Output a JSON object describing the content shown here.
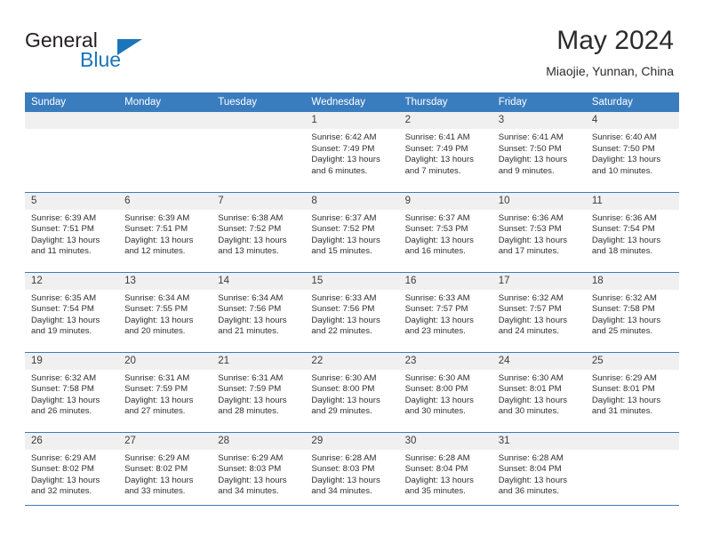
{
  "brand": {
    "name_part1": "General",
    "name_part2": "Blue",
    "logo_icon": "triangle-logo-icon",
    "accent_color": "#1b75bb"
  },
  "header": {
    "title": "May 2024",
    "location": "Miaojie, Yunnan, China"
  },
  "calendar": {
    "header_background": "#3a7dbf",
    "daynum_background": "#f0f0f0",
    "weekday_headers": [
      "Sunday",
      "Monday",
      "Tuesday",
      "Wednesday",
      "Thursday",
      "Friday",
      "Saturday"
    ],
    "weeks": [
      [
        {
          "day": "",
          "sunrise": "",
          "sunset": "",
          "daylight_line1": "",
          "daylight_line2": "",
          "empty": true
        },
        {
          "day": "",
          "sunrise": "",
          "sunset": "",
          "daylight_line1": "",
          "daylight_line2": "",
          "empty": true
        },
        {
          "day": "",
          "sunrise": "",
          "sunset": "",
          "daylight_line1": "",
          "daylight_line2": "",
          "empty": true
        },
        {
          "day": "1",
          "sunrise": "Sunrise: 6:42 AM",
          "sunset": "Sunset: 7:49 PM",
          "daylight_line1": "Daylight: 13 hours",
          "daylight_line2": "and 6 minutes.",
          "empty": false
        },
        {
          "day": "2",
          "sunrise": "Sunrise: 6:41 AM",
          "sunset": "Sunset: 7:49 PM",
          "daylight_line1": "Daylight: 13 hours",
          "daylight_line2": "and 7 minutes.",
          "empty": false
        },
        {
          "day": "3",
          "sunrise": "Sunrise: 6:41 AM",
          "sunset": "Sunset: 7:50 PM",
          "daylight_line1": "Daylight: 13 hours",
          "daylight_line2": "and 9 minutes.",
          "empty": false
        },
        {
          "day": "4",
          "sunrise": "Sunrise: 6:40 AM",
          "sunset": "Sunset: 7:50 PM",
          "daylight_line1": "Daylight: 13 hours",
          "daylight_line2": "and 10 minutes.",
          "empty": false
        }
      ],
      [
        {
          "day": "5",
          "sunrise": "Sunrise: 6:39 AM",
          "sunset": "Sunset: 7:51 PM",
          "daylight_line1": "Daylight: 13 hours",
          "daylight_line2": "and 11 minutes.",
          "empty": false
        },
        {
          "day": "6",
          "sunrise": "Sunrise: 6:39 AM",
          "sunset": "Sunset: 7:51 PM",
          "daylight_line1": "Daylight: 13 hours",
          "daylight_line2": "and 12 minutes.",
          "empty": false
        },
        {
          "day": "7",
          "sunrise": "Sunrise: 6:38 AM",
          "sunset": "Sunset: 7:52 PM",
          "daylight_line1": "Daylight: 13 hours",
          "daylight_line2": "and 13 minutes.",
          "empty": false
        },
        {
          "day": "8",
          "sunrise": "Sunrise: 6:37 AM",
          "sunset": "Sunset: 7:52 PM",
          "daylight_line1": "Daylight: 13 hours",
          "daylight_line2": "and 15 minutes.",
          "empty": false
        },
        {
          "day": "9",
          "sunrise": "Sunrise: 6:37 AM",
          "sunset": "Sunset: 7:53 PM",
          "daylight_line1": "Daylight: 13 hours",
          "daylight_line2": "and 16 minutes.",
          "empty": false
        },
        {
          "day": "10",
          "sunrise": "Sunrise: 6:36 AM",
          "sunset": "Sunset: 7:53 PM",
          "daylight_line1": "Daylight: 13 hours",
          "daylight_line2": "and 17 minutes.",
          "empty": false
        },
        {
          "day": "11",
          "sunrise": "Sunrise: 6:36 AM",
          "sunset": "Sunset: 7:54 PM",
          "daylight_line1": "Daylight: 13 hours",
          "daylight_line2": "and 18 minutes.",
          "empty": false
        }
      ],
      [
        {
          "day": "12",
          "sunrise": "Sunrise: 6:35 AM",
          "sunset": "Sunset: 7:54 PM",
          "daylight_line1": "Daylight: 13 hours",
          "daylight_line2": "and 19 minutes.",
          "empty": false
        },
        {
          "day": "13",
          "sunrise": "Sunrise: 6:34 AM",
          "sunset": "Sunset: 7:55 PM",
          "daylight_line1": "Daylight: 13 hours",
          "daylight_line2": "and 20 minutes.",
          "empty": false
        },
        {
          "day": "14",
          "sunrise": "Sunrise: 6:34 AM",
          "sunset": "Sunset: 7:56 PM",
          "daylight_line1": "Daylight: 13 hours",
          "daylight_line2": "and 21 minutes.",
          "empty": false
        },
        {
          "day": "15",
          "sunrise": "Sunrise: 6:33 AM",
          "sunset": "Sunset: 7:56 PM",
          "daylight_line1": "Daylight: 13 hours",
          "daylight_line2": "and 22 minutes.",
          "empty": false
        },
        {
          "day": "16",
          "sunrise": "Sunrise: 6:33 AM",
          "sunset": "Sunset: 7:57 PM",
          "daylight_line1": "Daylight: 13 hours",
          "daylight_line2": "and 23 minutes.",
          "empty": false
        },
        {
          "day": "17",
          "sunrise": "Sunrise: 6:32 AM",
          "sunset": "Sunset: 7:57 PM",
          "daylight_line1": "Daylight: 13 hours",
          "daylight_line2": "and 24 minutes.",
          "empty": false
        },
        {
          "day": "18",
          "sunrise": "Sunrise: 6:32 AM",
          "sunset": "Sunset: 7:58 PM",
          "daylight_line1": "Daylight: 13 hours",
          "daylight_line2": "and 25 minutes.",
          "empty": false
        }
      ],
      [
        {
          "day": "19",
          "sunrise": "Sunrise: 6:32 AM",
          "sunset": "Sunset: 7:58 PM",
          "daylight_line1": "Daylight: 13 hours",
          "daylight_line2": "and 26 minutes.",
          "empty": false
        },
        {
          "day": "20",
          "sunrise": "Sunrise: 6:31 AM",
          "sunset": "Sunset: 7:59 PM",
          "daylight_line1": "Daylight: 13 hours",
          "daylight_line2": "and 27 minutes.",
          "empty": false
        },
        {
          "day": "21",
          "sunrise": "Sunrise: 6:31 AM",
          "sunset": "Sunset: 7:59 PM",
          "daylight_line1": "Daylight: 13 hours",
          "daylight_line2": "and 28 minutes.",
          "empty": false
        },
        {
          "day": "22",
          "sunrise": "Sunrise: 6:30 AM",
          "sunset": "Sunset: 8:00 PM",
          "daylight_line1": "Daylight: 13 hours",
          "daylight_line2": "and 29 minutes.",
          "empty": false
        },
        {
          "day": "23",
          "sunrise": "Sunrise: 6:30 AM",
          "sunset": "Sunset: 8:00 PM",
          "daylight_line1": "Daylight: 13 hours",
          "daylight_line2": "and 30 minutes.",
          "empty": false
        },
        {
          "day": "24",
          "sunrise": "Sunrise: 6:30 AM",
          "sunset": "Sunset: 8:01 PM",
          "daylight_line1": "Daylight: 13 hours",
          "daylight_line2": "and 30 minutes.",
          "empty": false
        },
        {
          "day": "25",
          "sunrise": "Sunrise: 6:29 AM",
          "sunset": "Sunset: 8:01 PM",
          "daylight_line1": "Daylight: 13 hours",
          "daylight_line2": "and 31 minutes.",
          "empty": false
        }
      ],
      [
        {
          "day": "26",
          "sunrise": "Sunrise: 6:29 AM",
          "sunset": "Sunset: 8:02 PM",
          "daylight_line1": "Daylight: 13 hours",
          "daylight_line2": "and 32 minutes.",
          "empty": false
        },
        {
          "day": "27",
          "sunrise": "Sunrise: 6:29 AM",
          "sunset": "Sunset: 8:02 PM",
          "daylight_line1": "Daylight: 13 hours",
          "daylight_line2": "and 33 minutes.",
          "empty": false
        },
        {
          "day": "28",
          "sunrise": "Sunrise: 6:29 AM",
          "sunset": "Sunset: 8:03 PM",
          "daylight_line1": "Daylight: 13 hours",
          "daylight_line2": "and 34 minutes.",
          "empty": false
        },
        {
          "day": "29",
          "sunrise": "Sunrise: 6:28 AM",
          "sunset": "Sunset: 8:03 PM",
          "daylight_line1": "Daylight: 13 hours",
          "daylight_line2": "and 34 minutes.",
          "empty": false
        },
        {
          "day": "30",
          "sunrise": "Sunrise: 6:28 AM",
          "sunset": "Sunset: 8:04 PM",
          "daylight_line1": "Daylight: 13 hours",
          "daylight_line2": "and 35 minutes.",
          "empty": false
        },
        {
          "day": "31",
          "sunrise": "Sunrise: 6:28 AM",
          "sunset": "Sunset: 8:04 PM",
          "daylight_line1": "Daylight: 13 hours",
          "daylight_line2": "and 36 minutes.",
          "empty": false
        },
        {
          "day": "",
          "sunrise": "",
          "sunset": "",
          "daylight_line1": "",
          "daylight_line2": "",
          "empty": true
        }
      ]
    ]
  }
}
